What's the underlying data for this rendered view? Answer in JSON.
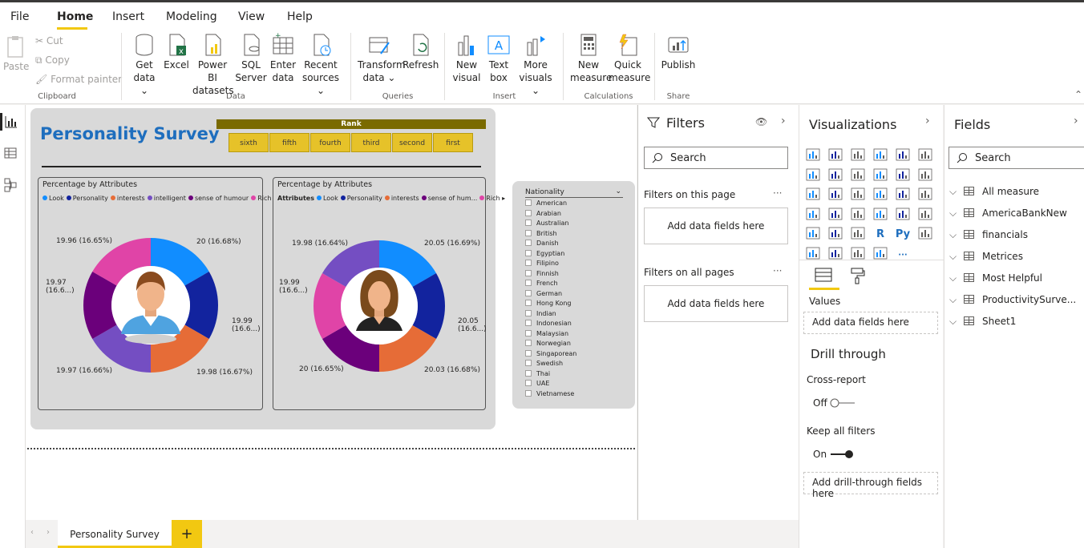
{
  "menu": {
    "file": "File",
    "home": "Home",
    "insert": "Insert",
    "modeling": "Modeling",
    "view": "View",
    "help": "Help"
  },
  "ribbon": {
    "paste": "Paste",
    "cut": "Cut",
    "copy": "Copy",
    "format_painter": "Format painter",
    "get_data": "Get data",
    "excel": "Excel",
    "power_bi": "Power BI datasets",
    "sql": "SQL Server",
    "enter_data": "Enter data",
    "recent_sources": "Recent sources",
    "transform": "Transform data",
    "refresh": "Refresh",
    "new_visual": "New visual",
    "text_box": "Text box",
    "more_visuals": "More visuals",
    "new_measure": "New measure",
    "quick_measure": "Quick measure",
    "publish": "Publish",
    "groups": {
      "clipboard": "Clipboard",
      "data": "Data",
      "queries": "Queries",
      "insert": "Insert",
      "calculations": "Calculations",
      "share": "Share"
    }
  },
  "report": {
    "title": "Personality Survey",
    "rank_header": "Rank",
    "rank_buttons": [
      "sixth",
      "fifth",
      "fourth",
      "third",
      "second",
      "first"
    ],
    "chart1": {
      "title": "Percentage by Attributes",
      "legend": [
        "Look",
        "Personality",
        "interests",
        "intelligent",
        "sense of humour",
        "Rich"
      ],
      "labels": [
        "20 (16.68%)",
        "19.99 (16.6...)",
        "19.98 (16.67%)",
        "19.97 (16.66%)",
        "19.97 (16.6...)",
        "19.96 (16.65%)"
      ]
    },
    "chart2": {
      "title": "Percentage by Attributes",
      "legend_title": "Attributes",
      "legend": [
        "Look",
        "Personality",
        "interests",
        "sense of hum...",
        "Rich"
      ],
      "labels": [
        "20.05 (16.69%)",
        "20.05 (16.6...)",
        "20.03 (16.68%)",
        "20 (16.65%)",
        "19.99 (16.6...)",
        "19.98 (16.64%)"
      ]
    },
    "nationality": {
      "title": "Nationality",
      "items": [
        "American",
        "Arabian",
        "Australian",
        "British",
        "Danish",
        "Egyptian",
        "Filipino",
        "Finnish",
        "French",
        "German",
        "Hong Kong",
        "Indian",
        "Indonesian",
        "Malaysian",
        "Norwegian",
        "Singaporean",
        "Swedish",
        "Thai",
        "UAE",
        "Vietnamese"
      ]
    }
  },
  "tabs": {
    "page1": "Personality Survey",
    "add": "+"
  },
  "filters": {
    "title": "Filters",
    "search": "Search",
    "on_page": "Filters on this page",
    "on_all": "Filters on all pages",
    "add_here": "Add data fields here",
    "more": "···"
  },
  "viz": {
    "title": "Visualizations",
    "values": "Values",
    "add_values": "Add data fields here",
    "drill": "Drill through",
    "cross_report": "Cross-report",
    "off": "Off",
    "keep_filters": "Keep all filters",
    "on": "On",
    "add_drill": "Add drill-through fields here"
  },
  "fields": {
    "title": "Fields",
    "search": "Search",
    "items": [
      "All measure",
      "AmericaBankNew",
      "financials",
      "Metrices",
      "Most Helpful",
      "ProductivitySurve...",
      "Sheet1"
    ]
  },
  "colors": {
    "accent": "#f2c811",
    "title_blue": "#1e6ebe",
    "series": [
      "#118dff",
      "#12239e",
      "#e66c37",
      "#6b007b",
      "#744ec2",
      "#d64550"
    ]
  }
}
